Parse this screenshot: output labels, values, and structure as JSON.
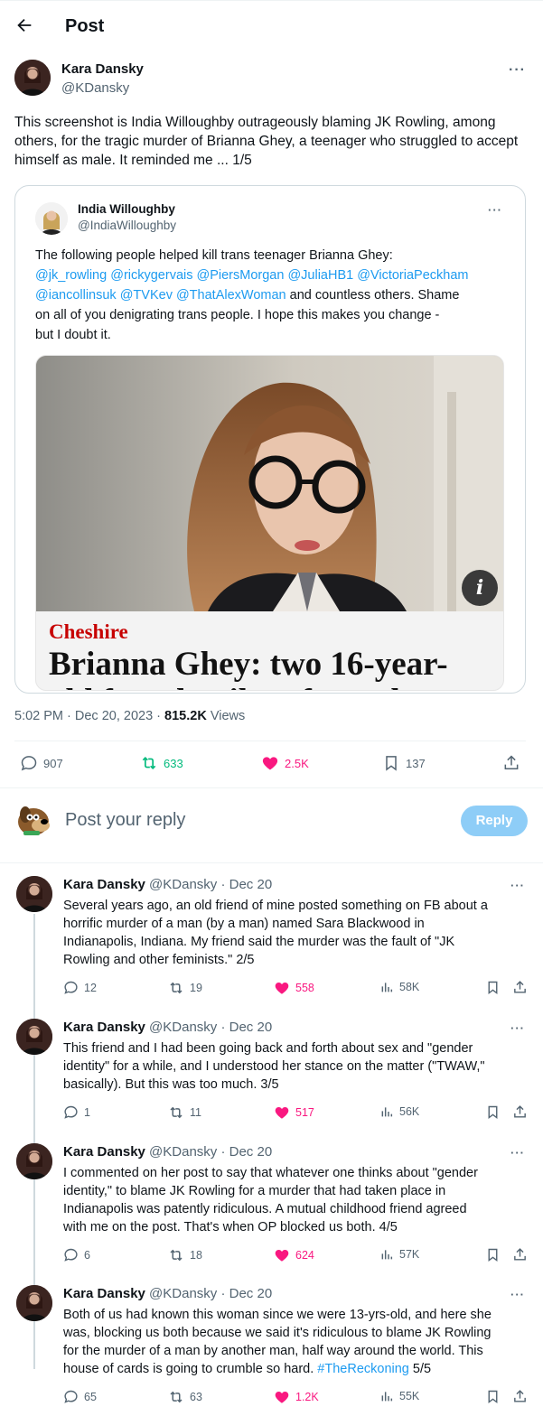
{
  "header": {
    "title": "Post"
  },
  "post": {
    "author": "Kara Dansky",
    "handle": "@KDansky",
    "text": "This screenshot is India Willoughby outrageously blaming JK Rowling, among others, for the tragic murder of Brianna Ghey, a teenager who struggled to accept himself as male. It reminded me ... 1/5",
    "quote": {
      "author": "India Willoughby",
      "handle": "@IndiaWilloughby",
      "line1": "The following people helped kill trans teenager Brianna Ghey:",
      "mentions1": "@jk_rowling @rickygervais @PiersMorgan @JuliaHB1 @VictoriaPeckham",
      "mentions2": "@iancollinsuk @TVKev @ThatAlexWoman",
      "line3_rest": " and countless others. Shame",
      "line4": "on all of you denigrating trans people. I hope this makes you change -",
      "line5": "but I doubt it.",
      "image": {
        "section": "Cheshire",
        "headline": "Brianna Ghey: two 16-year-",
        "headline_cut": "old found guilty of murder",
        "info_label": "i"
      }
    },
    "time": "5:02 PM · Dec 20, 2023 · ",
    "views_count": "815.2K",
    "views_label": " Views",
    "stats": {
      "replies": "907",
      "reposts": "633",
      "likes": "2.5K",
      "bookmarks": "137"
    }
  },
  "composer": {
    "placeholder": "Post your reply",
    "button": "Reply"
  },
  "colors": {
    "accent": "#1d9bf0",
    "repost": "#00ba7c",
    "like": "#f91880"
  },
  "replies": [
    {
      "name": "Kara Dansky",
      "meta": "@KDansky · Dec 20",
      "lines": [
        "Several years ago, an old friend of mine posted something on FB about a",
        "horrific murder of a man (by a man) named Sara Blackwood in",
        "Indianapolis, Indiana. My friend said the murder was the fault of \"JK",
        "Rowling and other feminists.\"  2/5"
      ],
      "replies": "12",
      "reposts": "19",
      "likes": "558",
      "views": "58K"
    },
    {
      "name": "Kara Dansky",
      "meta": "@KDansky · Dec 20",
      "lines": [
        "This friend and I had been going back and forth about sex and \"gender",
        "identity\" for a while, and I understood her stance on the matter (\"TWAW,\"",
        "basically). But this was too much. 3/5"
      ],
      "replies": "1",
      "reposts": "11",
      "likes": "517",
      "views": "56K"
    },
    {
      "name": "Kara Dansky",
      "meta": "@KDansky · Dec 20",
      "lines": [
        "I commented on her post to say that whatever one thinks about \"gender",
        "identity,\" to blame JK Rowling for a murder that had taken place in",
        "Indianapolis was patently ridiculous. A mutual childhood friend agreed",
        "with me on the post. That's when OP blocked us both. 4/5"
      ],
      "replies": "6",
      "reposts": "18",
      "likes": "624",
      "views": "57K"
    },
    {
      "name": "Kara Dansky",
      "meta": "@KDansky · Dec 20",
      "lines": [
        "Both of us had known this woman since we were 13-yrs-old, and here she",
        "was, blocking us both because we said it's ridiculous to blame JK Rowling",
        "for the murder of a man by another man, half way around the world. This",
        "house of cards is going to crumble so hard. "
      ],
      "hashtag": "#TheReckoning",
      "tail": " 5/5",
      "replies": "65",
      "reposts": "63",
      "likes": "1.2K",
      "views": "55K"
    }
  ]
}
